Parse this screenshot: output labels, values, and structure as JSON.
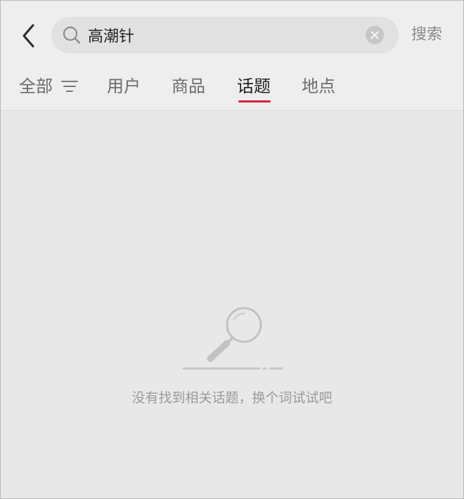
{
  "search": {
    "query": "高潮针",
    "submit_label": "搜索"
  },
  "tabs": [
    {
      "label": "全部",
      "active": false
    },
    {
      "label": "用户",
      "active": false
    },
    {
      "label": "商品",
      "active": false
    },
    {
      "label": "话题",
      "active": true
    },
    {
      "label": "地点",
      "active": false
    }
  ],
  "empty_state": {
    "message": "没有找到相关话题，换个词试试吧"
  },
  "colors": {
    "accent": "#d9203a",
    "background": "#e8e8e8",
    "header": "#eeeeee",
    "search_box": "#e1e1e1",
    "muted_text": "#9a9a9a"
  },
  "icons": {
    "back": "chevron-left-icon",
    "search": "search-icon",
    "clear": "clear-circle-icon",
    "filter": "filter-lines-icon",
    "empty": "magnifier-illustration-icon"
  }
}
